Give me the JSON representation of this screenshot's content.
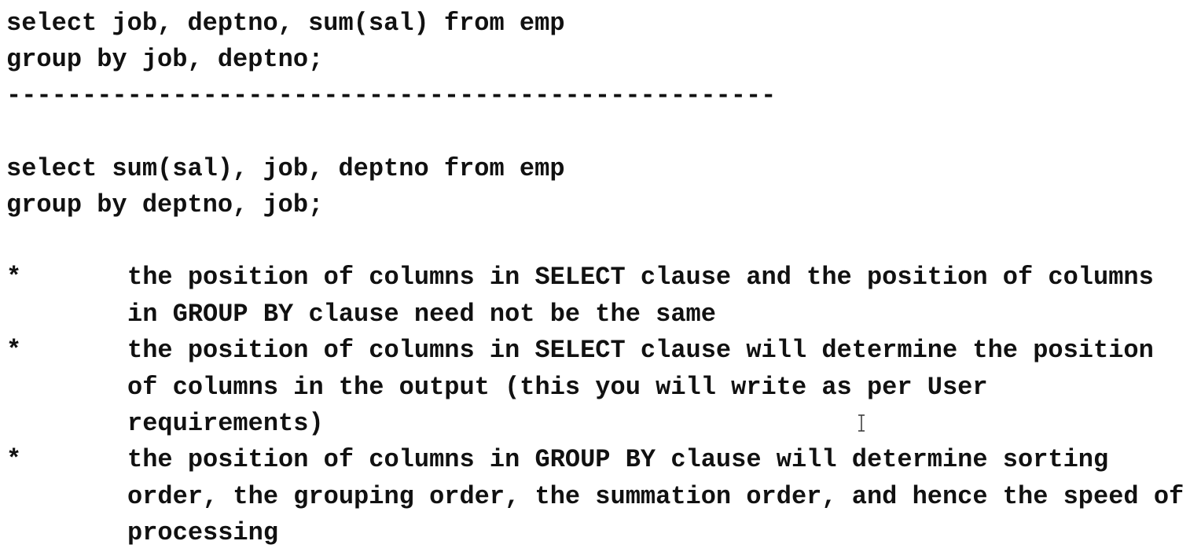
{
  "query1": {
    "line1": "select job, deptno, sum(sal) from emp",
    "line2": "group by job, deptno;"
  },
  "separator": "---------------------------------------------------",
  "query2": {
    "line1": "select sum(sal), job, deptno from emp",
    "line2": "group by deptno, job;"
  },
  "bullets": [
    {
      "marker": "*",
      "text": "the position of columns in SELECT clause and the position of columns in GROUP BY clause need not be the same"
    },
    {
      "marker": "*",
      "text": "the position of columns in SELECT clause will determine the position of columns in the output (this you will write as per User requirements)"
    },
    {
      "marker": "*",
      "text": "the position of columns in GROUP BY clause will determine sorting order, the grouping order, the summation order, and hence the speed of processing"
    }
  ],
  "cursor_icon": "text-cursor-icon"
}
